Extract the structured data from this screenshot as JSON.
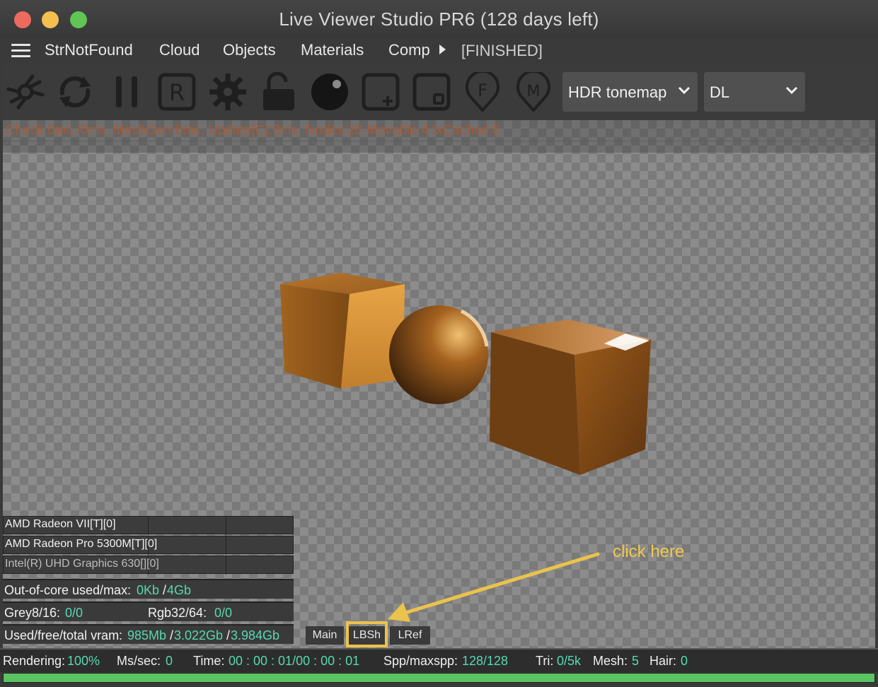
{
  "window": {
    "title": "Live Viewer Studio PR6 (128 days left)",
    "traffic_lights": {
      "close": "#ed6a5e",
      "minimize": "#f4bf4f",
      "zoom": "#61c554"
    }
  },
  "menubar": {
    "items": [
      "StrNotFound",
      "Cloud",
      "Objects",
      "Materials",
      "Comp"
    ],
    "status": "[FINISHED]"
  },
  "toolbar": {
    "icons": [
      "aperture-icon",
      "refresh-icon",
      "pause-icon",
      "r-box-icon",
      "gear-icon",
      "unlock-icon",
      "sphere-icon",
      "add-box-icon",
      "region-box-icon",
      "f-pin-icon",
      "m-pin-icon"
    ],
    "tonemap_select": "HDR tonemap",
    "kernel_select": "DL"
  },
  "viewport": {
    "stats_line": "Check:0ms./0ms. MeshGen:0ms. Update[C]:0ms. Nodes:20 Movable:4 txCached:0",
    "devices": [
      "AMD Radeon VII[T][0]",
      "AMD Radeon Pro 5300M[T][0]",
      "Intel(R) UHD Graphics 630[][0]"
    ],
    "out_of_core": {
      "label": "Out-of-core used/max:",
      "used": "0Kb",
      "sep": "/",
      "max": "4Gb"
    },
    "grey": {
      "label": "Grey8/16:",
      "value": "0/0"
    },
    "rgb": {
      "label": "Rgb32/64:",
      "value": "0/0"
    },
    "vram": {
      "label": "Used/free/total vram:",
      "used": "985Mb",
      "sep1": "/",
      "free": "3.022Gb",
      "sep2": "/",
      "total": "3.984Gb"
    },
    "tabs": [
      "Main",
      "LBSh",
      "LRef"
    ]
  },
  "annotation": {
    "text": "click here",
    "color": "#ebc34c"
  },
  "status": {
    "rendering_label": "Rendering:",
    "rendering_value": "100%",
    "mssec_label": "Ms/sec:",
    "mssec_value": "0",
    "time_label": "Time:",
    "time_value": "00 : 00 : 01/00 : 00 : 01",
    "spp_label": "Spp/maxspp:",
    "spp_value": "128/128",
    "tri_label": "Tri:",
    "tri_value": "0/5k",
    "mesh_label": "Mesh:",
    "mesh_value": "5",
    "hair_label": "Hair:",
    "hair_value": "0",
    "progress": 1.0
  },
  "colors": {
    "accent_value": "#56d9b0",
    "progress": "#5ac462",
    "stats_text": "#b5582a"
  }
}
